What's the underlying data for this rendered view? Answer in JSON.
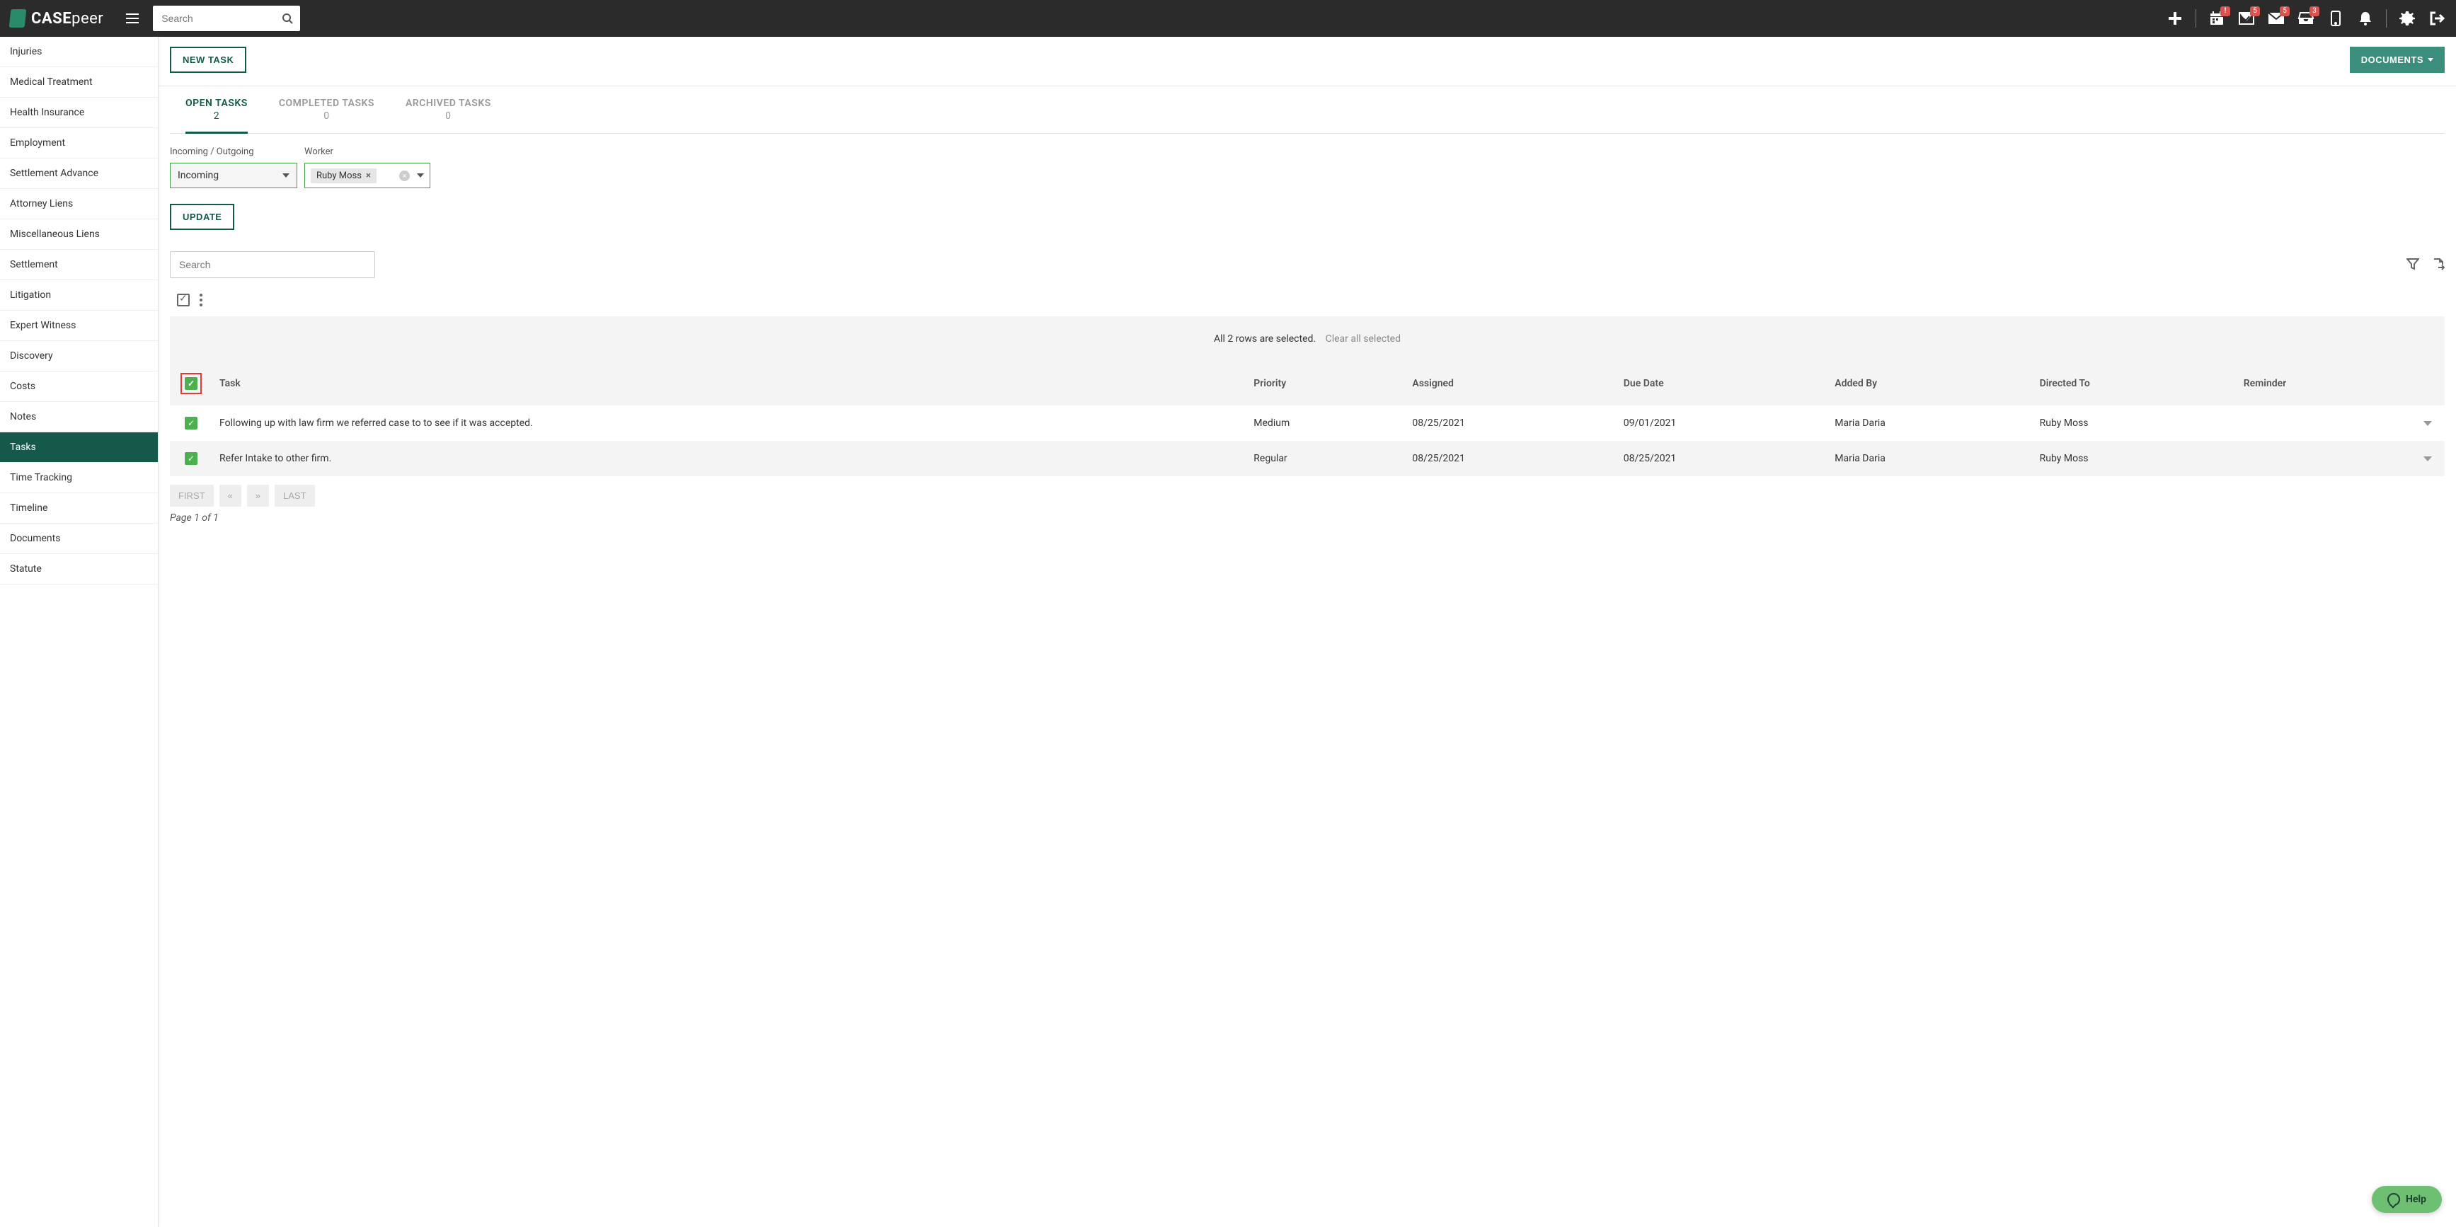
{
  "app": {
    "name_prefix": "CASE",
    "name_suffix": "peer"
  },
  "search": {
    "placeholder": "Search"
  },
  "topbar_badges": {
    "calendar": "!",
    "tasks": "5",
    "mail": "5",
    "inbox": "3"
  },
  "sidebar": {
    "items": [
      {
        "label": "Injuries"
      },
      {
        "label": "Medical Treatment"
      },
      {
        "label": "Health Insurance"
      },
      {
        "label": "Employment"
      },
      {
        "label": "Settlement Advance"
      },
      {
        "label": "Attorney Liens"
      },
      {
        "label": "Miscellaneous Liens"
      },
      {
        "label": "Settlement"
      },
      {
        "label": "Litigation"
      },
      {
        "label": "Expert Witness"
      },
      {
        "label": "Discovery"
      },
      {
        "label": "Costs"
      },
      {
        "label": "Notes"
      },
      {
        "label": "Tasks",
        "active": true
      },
      {
        "label": "Time Tracking"
      },
      {
        "label": "Timeline"
      },
      {
        "label": "Documents"
      },
      {
        "label": "Statute"
      }
    ]
  },
  "buttons": {
    "new_task": "NEW TASK",
    "documents": "DOCUMENTS",
    "update": "UPDATE"
  },
  "tabs": [
    {
      "label": "OPEN TASKS",
      "count": "2",
      "active": true
    },
    {
      "label": "COMPLETED TASKS",
      "count": "0"
    },
    {
      "label": "ARCHIVED TASKS",
      "count": "0"
    }
  ],
  "filters": {
    "direction_label": "Incoming / Outgoing",
    "direction_value": "Incoming",
    "worker_label": "Worker",
    "worker_chip": "Ruby Moss"
  },
  "table_search": {
    "placeholder": "Search"
  },
  "selection_banner": {
    "text": "All 2 rows are selected.",
    "clear": "Clear all selected"
  },
  "table": {
    "headers": {
      "task": "Task",
      "priority": "Priority",
      "assigned": "Assigned",
      "due": "Due Date",
      "added_by": "Added By",
      "directed_to": "Directed To",
      "reminder": "Reminder"
    },
    "rows": [
      {
        "task": "Following up with law firm we referred case to to see if it was accepted.",
        "priority": "Medium",
        "assigned": "08/25/2021",
        "due": "09/01/2021",
        "added_by": "Maria Daria",
        "directed_to": "Ruby Moss",
        "reminder": ""
      },
      {
        "task": "Refer Intake to other firm.",
        "priority": "Regular",
        "assigned": "08/25/2021",
        "due": "08/25/2021",
        "added_by": "Maria Daria",
        "directed_to": "Ruby Moss",
        "reminder": ""
      }
    ]
  },
  "pagination": {
    "first": "FIRST",
    "last": "LAST",
    "info": "Page 1 of 1"
  },
  "help": {
    "label": "Help"
  }
}
